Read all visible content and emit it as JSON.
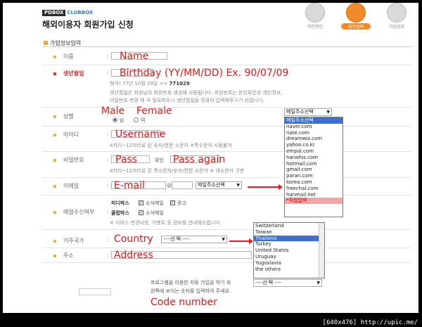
{
  "header": {
    "brand_pd": "PDBOX",
    "brand_club": "CLUBBOX",
    "title": "해외이용자 회원가입 신청",
    "steps": [
      "약관확인",
      "정보입력",
      "가입완료"
    ]
  },
  "section_title": "가입정보입력",
  "fields": {
    "name": {
      "label": "이름",
      "annotation": "Name"
    },
    "birthday": {
      "label": "생년월일",
      "annotation": "Birthday (YY/MM/DD) Ex. 90/07/09",
      "format_hint": "형식) 77년 10월 29일 =>",
      "format_example": "771029",
      "note_line1": "생년월일은 회원님의 회원번호 생성에 사용됩니다. 회원번호는 본인확인과 개인정보,",
      "note_line2": "비밀번호 변경 때 꼭 필요하오니 생년월일을 정확히 입력해주시기 바랍니다."
    },
    "gender": {
      "label": "성별",
      "annotation_male": "Male",
      "annotation_female": "Female",
      "male_option": "남",
      "female_option": "여"
    },
    "id": {
      "label": "아이디",
      "annotation": "Username",
      "hint": "4자리~12자리로 된 숫자/영문 소문자 ※특수문자 사용불가"
    },
    "password": {
      "label": "비밀번호",
      "annotation": "Pass",
      "confirm_label": "확인",
      "annotation_confirm": "Pass again",
      "hint": "4자리~12자리로 된 특수문자/숫자/영문 소문자 ※ 대소문자 구분"
    },
    "email": {
      "label": "이메일",
      "annotation": "E-mail",
      "at": "@",
      "select_value": "메일주소선택"
    },
    "mail_receive": {
      "label": "메일수신여부",
      "row1_name": "피디박스",
      "row1_opt1": "소식메일",
      "row1_opt2": "광고",
      "row2_name": "클럽박스",
      "row2_opt1": "소식메일",
      "note": "※ 서비스 변경사항, 이벤트 등 정보를 안내해드립니다."
    },
    "country": {
      "label": "거주국가",
      "annotation": "Country",
      "select_value": "----선 택 ----"
    },
    "address": {
      "label": "주소",
      "annotation": "Address"
    },
    "code": {
      "note_line1": "프로그램을 이용한 자동 가입을 막기 위",
      "note_line2": "왼쪽에 보이는 숫자를 입력하여 주세요.",
      "annotation": "Code number",
      "select_value": "----선 택 ----"
    }
  },
  "email_dropdown": {
    "selected_top": "메일주소선택",
    "options": [
      "메일주소선택",
      "naver.com",
      "nate.com",
      "dreamwiz.com",
      "yahoo.co.kr",
      "empal.com",
      "hanafos.com",
      "hotmail.com",
      "gmail.com",
      "paran.com",
      "korea.com",
      "freechal.com",
      "hanmail.net",
      "*직접입력"
    ],
    "highlighted_index": 0,
    "custom_index": 13
  },
  "country_dropdown": {
    "options": [
      "Switzerland",
      "Taiwan",
      "Thailand",
      "Turkey",
      "United States",
      "Uruguay",
      "Yugoslavia",
      "the others"
    ],
    "highlighted_index": 2
  },
  "footer": "[640x476] http://upic.me/",
  "colors": {
    "annotation": "#e01a1a",
    "accent": "#f08a2a",
    "highlight": "#3a6fd6"
  }
}
